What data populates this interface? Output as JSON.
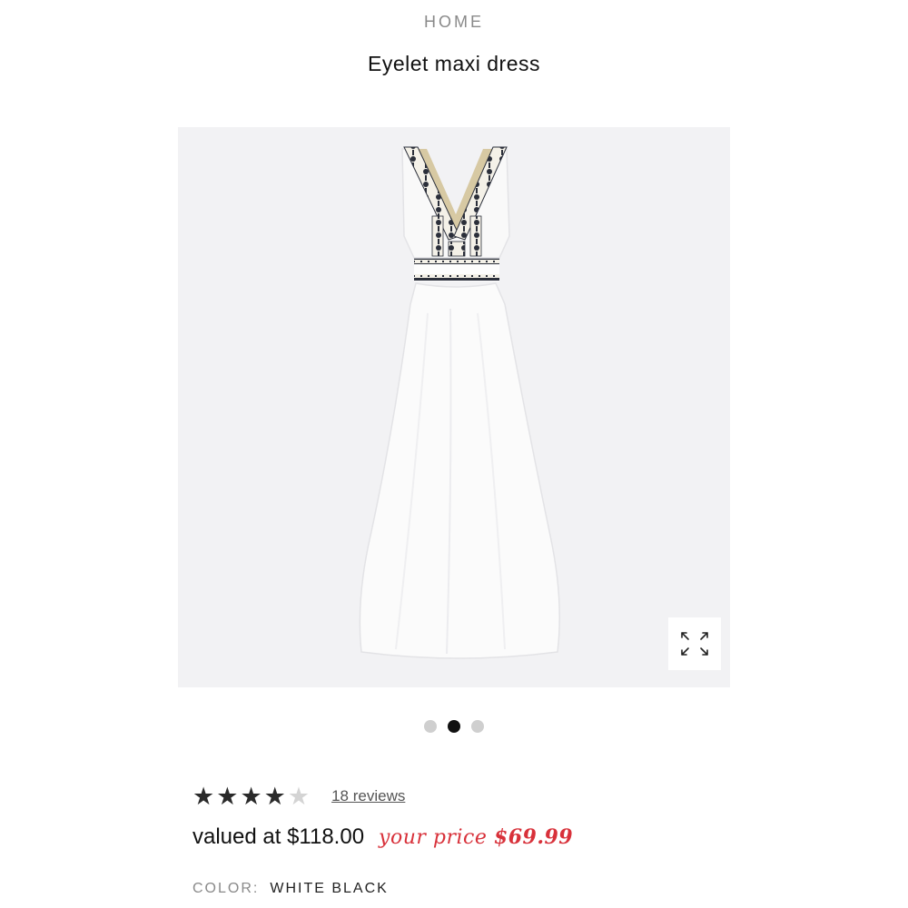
{
  "breadcrumb": {
    "label": "HOME"
  },
  "product": {
    "title": "Eyelet maxi dress",
    "image_alt": "white dress with black embroidered trim",
    "rating": 4,
    "rating_max": 5,
    "reviews_label": "18 reviews",
    "valued_label": "valued at $118.00",
    "your_price_prefix": "your price",
    "your_price_amount": "$69.99",
    "color_label": "COLOR:",
    "color_value": "WHITE BLACK"
  },
  "carousel": {
    "count": 3,
    "active_index": 1
  },
  "icons": {
    "zoom": "expand-arrows-icon",
    "star": "star-icon"
  },
  "colors": {
    "price_red": "#d8313a",
    "image_bg": "#f2f2f4",
    "dot_active": "#111111",
    "dot_inactive": "#cfcfcf"
  }
}
